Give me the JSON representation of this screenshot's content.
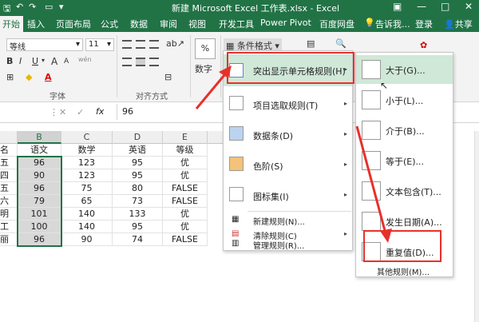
{
  "window": {
    "title": "新建 Microsoft Excel 工作表.xlsx - Excel",
    "min": "—",
    "max": "□",
    "close": "✕",
    "ribbon_opt": "▣"
  },
  "tabs": [
    {
      "label": "开始",
      "active": true
    },
    {
      "label": "插入"
    },
    {
      "label": "页面布局"
    },
    {
      "label": "公式"
    },
    {
      "label": "数据"
    },
    {
      "label": "审阅"
    },
    {
      "label": "视图"
    },
    {
      "label": "开发工具"
    },
    {
      "label": "Power Pivot"
    },
    {
      "label": "百度网盘"
    }
  ],
  "tell_me": "告诉我...",
  "login": "登录",
  "share": "共享",
  "ribbon": {
    "font_name": "等线",
    "font_size": "11",
    "bold": "B",
    "italic": "I",
    "underline": "U",
    "grow": "A",
    "shrink": "A",
    "wen": "wén",
    "font_color": "A",
    "font_group": "字体",
    "align_group": "对齐方式",
    "percent": "%",
    "number_label": "数字",
    "cond_format": "条件格式"
  },
  "formula_bar": {
    "cancel": "✕",
    "enter": "✓",
    "fx": "fx",
    "value": "96"
  },
  "grid": {
    "columns": [
      "B",
      "C",
      "D",
      "E"
    ],
    "left_partial": [
      "名",
      "五",
      "四",
      "五",
      "六",
      "明",
      "工",
      "丽"
    ],
    "rows": [
      [
        "语文",
        "数学",
        "英语",
        "等级"
      ],
      [
        "96",
        "123",
        "95",
        "优"
      ],
      [
        "90",
        "123",
        "95",
        "优"
      ],
      [
        "96",
        "75",
        "80",
        "FALSE"
      ],
      [
        "79",
        "65",
        "73",
        "FALSE"
      ],
      [
        "101",
        "140",
        "133",
        "优"
      ],
      [
        "100",
        "140",
        "95",
        "优"
      ],
      [
        "96",
        "90",
        "74",
        "FALSE"
      ]
    ]
  },
  "menu": {
    "items": [
      {
        "label": "突出显示单元格规则(H)",
        "arrow": "▸"
      },
      {
        "label": "项目选取规则(T)",
        "arrow": "▸"
      },
      {
        "label": "数据条(D)",
        "arrow": "▸"
      },
      {
        "label": "色阶(S)",
        "arrow": "▸"
      },
      {
        "label": "图标集(I)",
        "arrow": "▸"
      },
      {
        "label": "新建规则(N)..."
      },
      {
        "label": "清除规则(C)",
        "arrow": "▸"
      },
      {
        "label": "管理规则(R)..."
      }
    ]
  },
  "submenu": {
    "items": [
      {
        "label": "大于(G)..."
      },
      {
        "label": "小于(L)..."
      },
      {
        "label": "介于(B)..."
      },
      {
        "label": "等于(E)..."
      },
      {
        "label": "文本包含(T)..."
      },
      {
        "label": "发生日期(A)..."
      },
      {
        "label": "重复值(D)..."
      }
    ],
    "more": "其他规则(M)..."
  },
  "colors": {
    "excel_green": "#217346",
    "highlight": "#cfe8d8",
    "annotation_red": "#e8302a"
  }
}
